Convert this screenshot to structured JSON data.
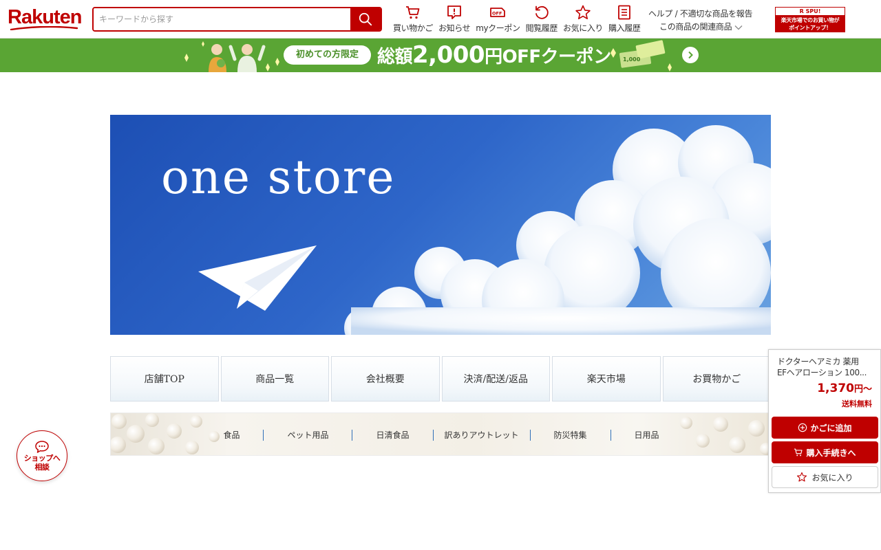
{
  "header": {
    "logo": "Rakuten",
    "search_placeholder": "キーワードから探す",
    "nav": [
      {
        "label": "買い物かご",
        "icon": "cart-icon"
      },
      {
        "label": "お知らせ",
        "icon": "notice-icon"
      },
      {
        "label": "myクーポン",
        "icon": "coupon-icon"
      },
      {
        "label": "閲覧履歴",
        "icon": "history-icon"
      },
      {
        "label": "お気に入り",
        "icon": "star-icon"
      },
      {
        "label": "購入履歴",
        "icon": "purchase-list-icon"
      }
    ],
    "help_report": "ヘルプ / 不適切な商品を報告",
    "related_items": "この商品の関連商品",
    "spu_label": "R SPU!",
    "spu_text_line1": "楽天市場でのお買い物が",
    "spu_text_line2": "ポイントアップ！"
  },
  "campaign": {
    "pill": "初めての方限定",
    "text_prefix": "総額",
    "amount": "2,000",
    "text_suffix": "円OFFクーポン",
    "ticket": "1,000"
  },
  "store": {
    "title": "one store",
    "nav": [
      "店舗TOP",
      "商品一覧",
      "会社概要",
      "決済/配送/返品",
      "楽天市場",
      "お買物かご"
    ],
    "categories": [
      "食品",
      "ペット用品",
      "日清食品",
      "訳ありアウトレット",
      "防災特集",
      "日用品"
    ]
  },
  "cart_panel": {
    "product_line1": "ドクターヘアミカ 薬用",
    "product_line2": "EFヘアローション 100...",
    "price": "1,370",
    "price_unit": "円〜",
    "shipping": "送料無料",
    "add_to_cart": "かごに追加",
    "checkout": "購入手続きへ",
    "favorite": "お気に入り"
  },
  "chat": {
    "line1": "ショップへ",
    "line2": "相談"
  },
  "colors": {
    "brand": "#bf0000",
    "campaign_green": "#5aa534",
    "hero_blue": "#2e66c9"
  }
}
